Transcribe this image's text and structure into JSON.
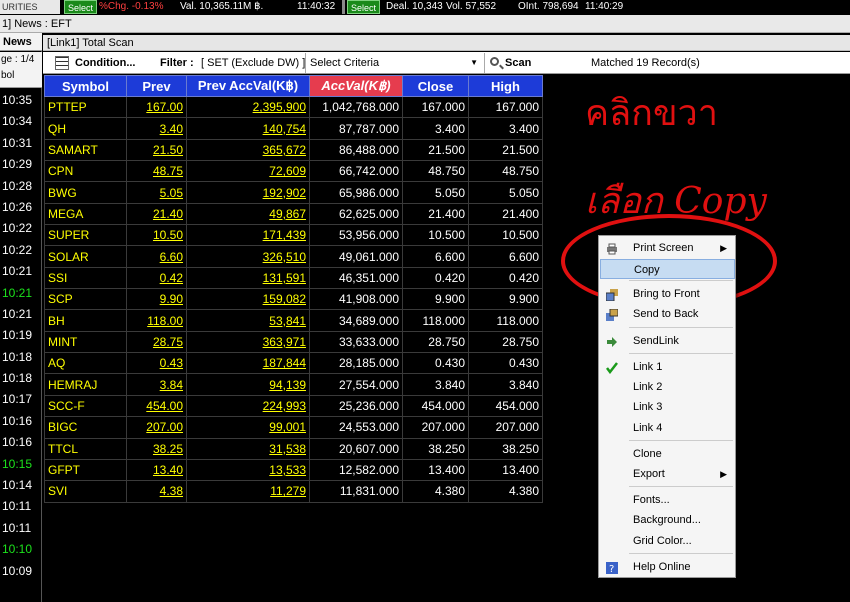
{
  "ticker": {
    "brand": "URITIES",
    "select1": "Select",
    "pctchg": "%Chg. -0.13%",
    "val": "Val. 10,365.11M ฿.",
    "time1": "11:40:32",
    "select2": "Select",
    "deal": "Deal. 10,343",
    "vol": "Vol. 57,552",
    "oint": "OInt. 798,694",
    "time2": "11:40:29"
  },
  "newsbar": {
    "text": "1] News : EFT"
  },
  "left_panel": {
    "tab": "News",
    "page": "ge : 1/4",
    "col": "bol",
    "times": [
      {
        "t": "10:35",
        "green": false
      },
      {
        "t": "10:34",
        "green": false
      },
      {
        "t": "10:31",
        "green": false
      },
      {
        "t": "10:29",
        "green": false
      },
      {
        "t": "10:28",
        "green": false
      },
      {
        "t": "10:26",
        "green": false
      },
      {
        "t": "10:22",
        "green": false
      },
      {
        "t": "10:22",
        "green": false
      },
      {
        "t": "10:21",
        "green": false
      },
      {
        "t": "10:21",
        "green": true
      },
      {
        "t": "10:21",
        "green": false
      },
      {
        "t": "10:19",
        "green": false
      },
      {
        "t": "10:18",
        "green": false
      },
      {
        "t": "10:18",
        "green": false
      },
      {
        "t": "10:17",
        "green": false
      },
      {
        "t": "10:16",
        "green": false
      },
      {
        "t": "10:16",
        "green": false
      },
      {
        "t": "10:15",
        "green": true
      },
      {
        "t": "10:14",
        "green": false
      },
      {
        "t": "10:11",
        "green": false
      },
      {
        "t": "10:11",
        "green": false
      },
      {
        "t": "10:10",
        "green": true
      },
      {
        "t": "10:09",
        "green": false
      }
    ]
  },
  "window": {
    "title": "[Link1] Total Scan"
  },
  "toolbar": {
    "condition_label": "Condition...",
    "filter_label": "Filter :",
    "filter_value": "[ SET (Exclude DW) ]",
    "criteria_label": "Select Criteria",
    "scan_label": "Scan",
    "matched_label": "Matched 19 Record(s)"
  },
  "table": {
    "columns": [
      "Symbol",
      "Prev",
      "Prev AccVal(K฿)",
      "AccVal(K฿)",
      "Close",
      "High"
    ],
    "rows": [
      [
        "PTTEP",
        "167.00",
        "2,395,900",
        "1,042,768.000",
        "167.000",
        "167.000"
      ],
      [
        "QH",
        "3.40",
        "140,754",
        "87,787.000",
        "3.400",
        "3.400"
      ],
      [
        "SAMART",
        "21.50",
        "365,672",
        "86,488.000",
        "21.500",
        "21.500"
      ],
      [
        "CPN",
        "48.75",
        "72,609",
        "66,742.000",
        "48.750",
        "48.750"
      ],
      [
        "BWG",
        "5.05",
        "192,902",
        "65,986.000",
        "5.050",
        "5.050"
      ],
      [
        "MEGA",
        "21.40",
        "49,867",
        "62,625.000",
        "21.400",
        "21.400"
      ],
      [
        "SUPER",
        "10.50",
        "171,439",
        "53,956.000",
        "10.500",
        "10.500"
      ],
      [
        "SOLAR",
        "6.60",
        "326,510",
        "49,061.000",
        "6.600",
        "6.600"
      ],
      [
        "SSI",
        "0.42",
        "131,591",
        "46,351.000",
        "0.420",
        "0.420"
      ],
      [
        "SCP",
        "9.90",
        "159,082",
        "41,908.000",
        "9.900",
        "9.900"
      ],
      [
        "BH",
        "118.00",
        "53,841",
        "34,689.000",
        "118.000",
        "118.000"
      ],
      [
        "MINT",
        "28.75",
        "363,971",
        "33,633.000",
        "28.750",
        "28.750"
      ],
      [
        "AQ",
        "0.43",
        "187,844",
        "28,185.000",
        "0.430",
        "0.430"
      ],
      [
        "HEMRAJ",
        "3.84",
        "94,139",
        "27,554.000",
        "3.840",
        "3.840"
      ],
      [
        "SCC-F",
        "454.00",
        "224,993",
        "25,236.000",
        "454.000",
        "454.000"
      ],
      [
        "BIGC",
        "207.00",
        "99,001",
        "24,553.000",
        "207.000",
        "207.000"
      ],
      [
        "TTCL",
        "38.25",
        "31,538",
        "20,607.000",
        "38.250",
        "38.250"
      ],
      [
        "GFPT",
        "13.40",
        "13,533",
        "12,582.000",
        "13.400",
        "13.400"
      ],
      [
        "SVI",
        "4.38",
        "11,279",
        "11,831.000",
        "4.380",
        "4.380"
      ]
    ]
  },
  "annotations": {
    "line1": "คลิกขวา",
    "line2": "เลือก Copy"
  },
  "context_menu": {
    "items": [
      {
        "label": "Print Screen",
        "submenu": true,
        "icon": "printer-icon"
      },
      {
        "label": "Copy",
        "highlighted": true
      },
      {
        "label": "Bring to Front",
        "icon": "bring-front-icon"
      },
      {
        "label": "Send to Back",
        "icon": "send-back-icon"
      },
      {
        "label": "SendLink",
        "icon": "arrow-right-icon"
      },
      {
        "label": "Link 1",
        "icon": "check-icon"
      },
      {
        "label": "Link 2"
      },
      {
        "label": "Link 3"
      },
      {
        "label": "Link 4"
      },
      {
        "label": "Clone"
      },
      {
        "label": "Export",
        "submenu": true
      },
      {
        "label": "Fonts..."
      },
      {
        "label": "Background..."
      },
      {
        "label": "Grid Color..."
      },
      {
        "label": "Help Online",
        "icon": "help-icon"
      }
    ]
  },
  "colors": {
    "header_blue": "#1d3bd8",
    "sorted_red": "#e63c4e",
    "symbol_yellow": "#ffff00",
    "annotation_red": "#e01010"
  }
}
